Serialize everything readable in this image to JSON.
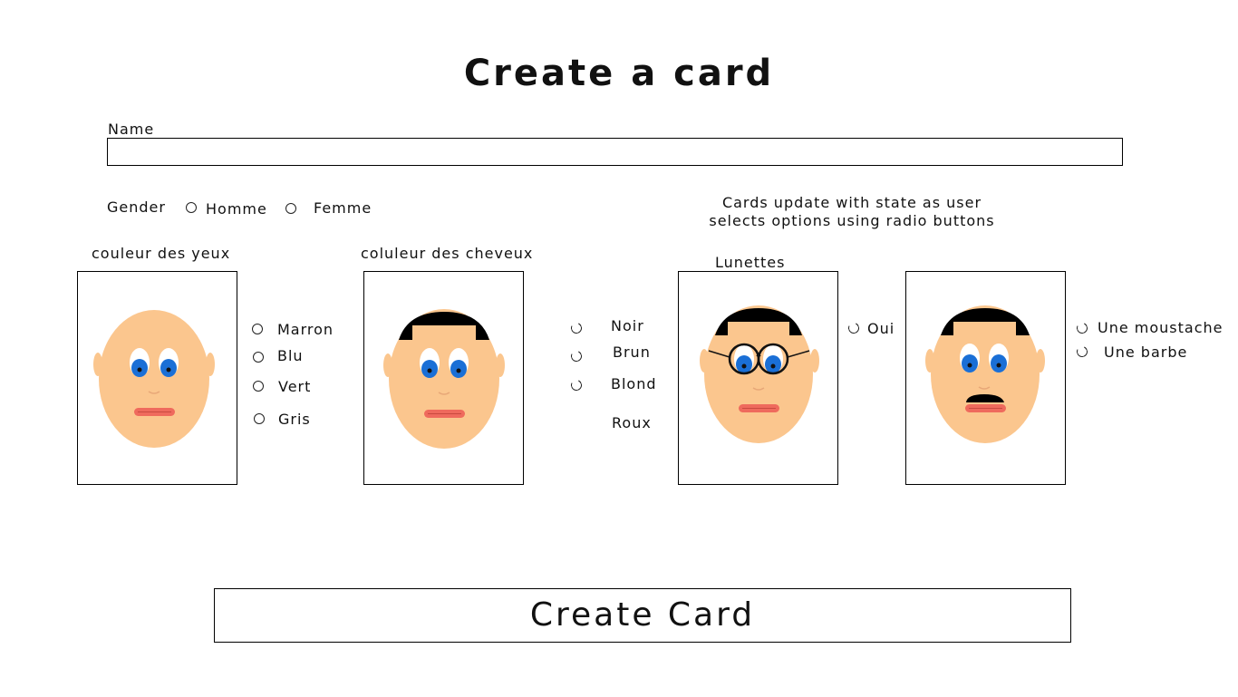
{
  "page": {
    "title": "Create a card"
  },
  "name_field": {
    "label": "Name",
    "value": "",
    "placeholder": ""
  },
  "gender": {
    "label": "Gender",
    "options": [
      "Homme",
      "Femme"
    ]
  },
  "note": {
    "line1": "Cards update with state as user",
    "line2": "selects options using radio buttons"
  },
  "eyes": {
    "label": "couleur des yeux",
    "options": [
      "Marron",
      "Blu",
      "Vert",
      "Gris"
    ]
  },
  "hair": {
    "label": "coluleur des cheveux",
    "options": [
      "Noir",
      "Brun",
      "Blond",
      "Roux"
    ]
  },
  "glasses": {
    "label": "Lunettes",
    "options": [
      "Oui"
    ]
  },
  "facial_hair": {
    "options": [
      "Une moustache",
      "Une barbe"
    ]
  },
  "submit": {
    "label": "Create Card"
  },
  "colors": {
    "skin": "#fbc68e",
    "eye_iris": "#1a6fd6",
    "lips": "#ef6a5d",
    "hair": "#000000",
    "border": "#000000"
  }
}
